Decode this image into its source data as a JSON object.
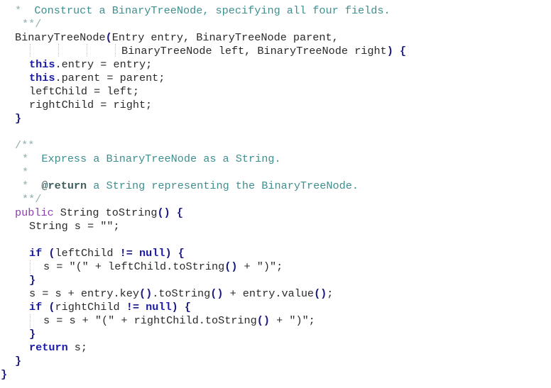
{
  "editor": {
    "language": "java",
    "lines": {
      "l0": {
        "star": "*",
        "text": "Construct a BinaryTreeNode, specifying all four fields."
      },
      "l1": {
        "end": "**/"
      },
      "l2": {
        "name": "BinaryTreeNode",
        "paren": "(",
        "params": "Entry entry, BinaryTreeNode parent,"
      },
      "l3": {
        "params": "BinaryTreeNode left, BinaryTreeNode right",
        "close": ")",
        "brace": "{"
      },
      "l4": {
        "kw": "this",
        "rest": ".entry = entry;"
      },
      "l5": {
        "kw": "this",
        "rest": ".parent = parent;"
      },
      "l6": {
        "text": "leftChild = left;"
      },
      "l7": {
        "text": "rightChild = right;"
      },
      "l8": {
        "brace": "}"
      },
      "l9": {
        "start": "/**"
      },
      "l10": {
        "star": "*",
        "text": "Express a BinaryTreeNode as a String."
      },
      "l11": {
        "star": "*"
      },
      "l12": {
        "star": "*",
        "tag": "@return",
        "text": " a String representing the BinaryTreeNode."
      },
      "l13": {
        "end": "**/"
      },
      "l14": {
        "mod": "public",
        "rest": " String toString",
        "parens": "()",
        "brace": "{"
      },
      "l15": {
        "text": "String s = \"\";"
      },
      "l16": {
        "kw": "if",
        "a": " ",
        "p1": "(",
        "b": "leftChild ",
        "op": "!=",
        "c": " ",
        "kw2": "null",
        "p2": ")",
        "d": " ",
        "brace": "{"
      },
      "l17": {
        "a": "s = \"(\" + leftChild.toString",
        "parens": "()",
        "b": " + \")\";"
      },
      "l18": {
        "brace": "}"
      },
      "l19": {
        "a": "s = s + entry.key",
        "p1": "()",
        "b": ".toString",
        "p2": "()",
        "c": " + entry.value",
        "p3": "()",
        "d": ";"
      },
      "l20": {
        "kw": "if",
        "a": " ",
        "p1": "(",
        "b": "rightChild ",
        "op": "!=",
        "c": " ",
        "kw2": "null",
        "p2": ")",
        "d": " ",
        "brace": "{"
      },
      "l21": {
        "a": "s = s + \"(\" + rightChild.toString",
        "parens": "()",
        "b": " + \")\";"
      },
      "l22": {
        "brace": "}"
      },
      "l23": {
        "kw": "return",
        "rest": " s;"
      },
      "l24": {
        "brace": "}"
      },
      "l25": {
        "brace": "}"
      }
    }
  }
}
